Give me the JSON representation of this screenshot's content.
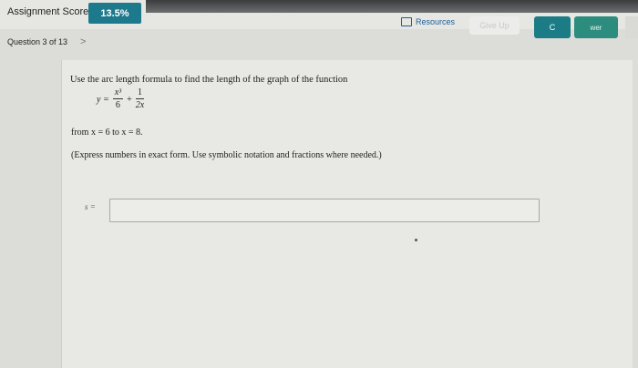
{
  "header": {
    "score_label": "Assignment Score:",
    "score_value": "13.5%",
    "resources_label": "Resources",
    "blurred_button_label": "Give Up",
    "teal_button_label": "C",
    "answer_button_label": "wer"
  },
  "navigation": {
    "question_label": "Question 3 of 13",
    "next_chevron": ">"
  },
  "question": {
    "prompt": "Use the arc length formula to find the length of the graph of the function",
    "formula": {
      "lhs": "y =",
      "frac1_num": "x³",
      "frac1_den": "6",
      "plus": "+",
      "frac2_num": "1",
      "frac2_den": "2x"
    },
    "range": "from x = 6 to x = 8.",
    "note": "(Express numbers in exact form. Use symbolic notation and fractions where needed.)"
  },
  "answer": {
    "label": "s =",
    "value": ""
  }
}
